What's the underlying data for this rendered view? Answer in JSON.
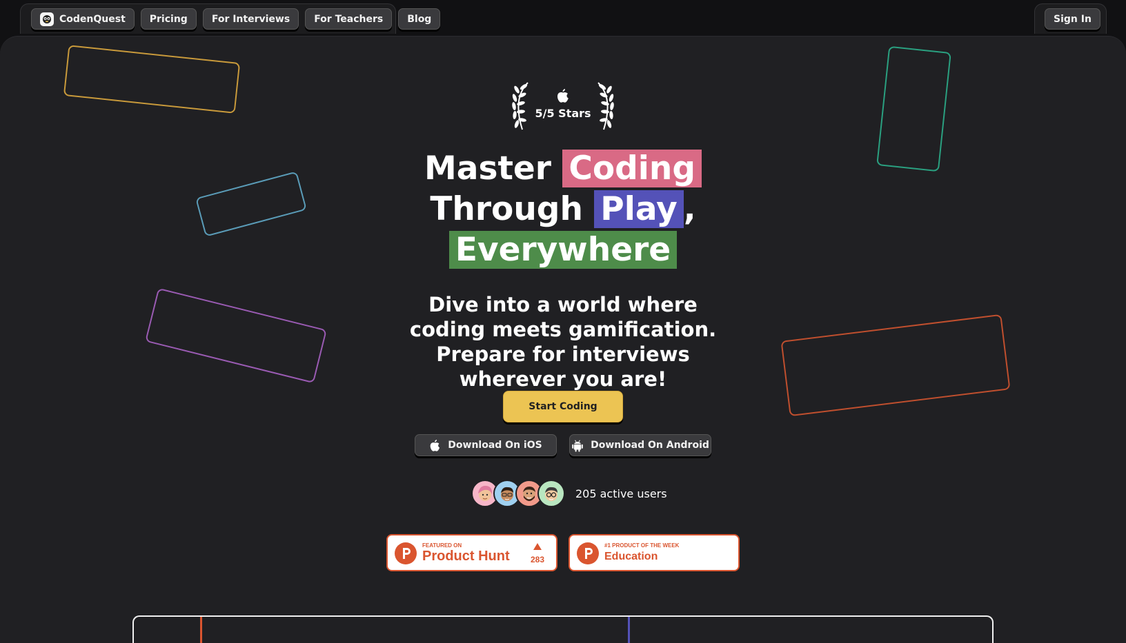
{
  "nav": {
    "brand": "CodenQuest",
    "links": [
      "Pricing",
      "For Interviews",
      "For Teachers",
      "Blog"
    ],
    "sign_in": "Sign In"
  },
  "award": {
    "text": "5/5 Stars",
    "icon": "apple-icon"
  },
  "headline": {
    "word1": "Master",
    "highlight1": "Coding",
    "word2": "Through",
    "highlight2": "Play",
    "comma": ",",
    "highlight3": "Everywhere"
  },
  "subheading": "Dive into a world where coding meets gamification. Prepare for interviews wherever you are!",
  "cta": "Start Coding",
  "downloads": {
    "ios": "Download On iOS",
    "android": "Download On Android"
  },
  "users": {
    "count_text": "205 active users",
    "avatars": [
      "avatar-1",
      "avatar-2",
      "avatar-3",
      "avatar-4"
    ]
  },
  "badges": {
    "producthunt": {
      "small": "FEATURED ON",
      "big": "Product Hunt",
      "votes": "283"
    },
    "week": {
      "small": "#1 PRODUCT OF THE WEEK",
      "big": "Education"
    }
  },
  "colors": {
    "coding_highlight": "#d96a85",
    "play_highlight": "#5452b8",
    "everywhere_highlight": "#4e8c4a",
    "cta": "#ecc453",
    "producthunt": "#da552f"
  }
}
